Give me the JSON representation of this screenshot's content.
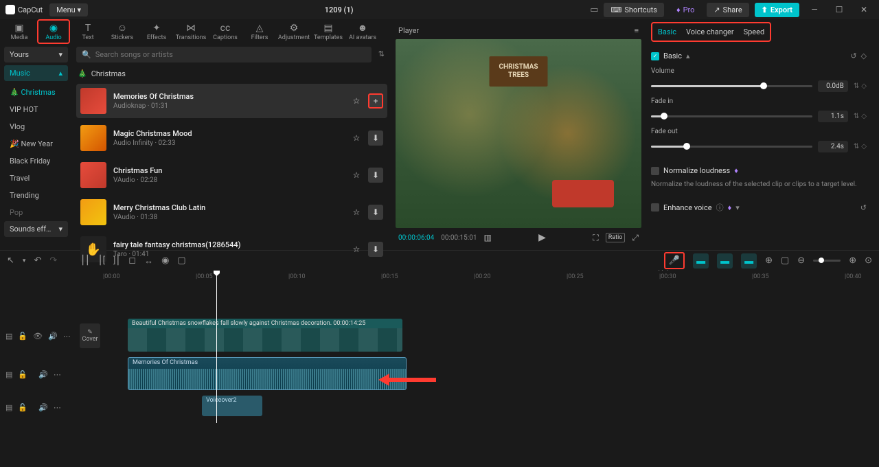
{
  "app": {
    "name": "CapCut",
    "menu": "Menu",
    "title": "1209 (1)"
  },
  "titlebar": {
    "shortcuts": "Shortcuts",
    "pro": "Pro",
    "share": "Share",
    "export": "Export"
  },
  "tools": {
    "media": "Media",
    "audio": "Audio",
    "text": "Text",
    "stickers": "Stickers",
    "effects": "Effects",
    "transitions": "Transitions",
    "captions": "Captions",
    "filters": "Filters",
    "adjustment": "Adjustment",
    "templates": "Templates",
    "avatars": "AI avatars"
  },
  "sidebar": {
    "yours": "Yours",
    "music": "Music",
    "cats": [
      "Christmas",
      "VIP HOT",
      "Vlog",
      "New Year",
      "Black Friday",
      "Travel",
      "Trending",
      "Pop"
    ],
    "sounds": "Sounds eff…"
  },
  "search": {
    "placeholder": "Search songs or artists"
  },
  "breadcrumb": "Christmas",
  "songs": [
    {
      "title": "Memories Of Christmas",
      "meta": "Audioknap · 01:31"
    },
    {
      "title": "Magic Christmas Mood",
      "meta": "Audio Infinity · 02:33"
    },
    {
      "title": "Christmas Fun",
      "meta": "VAudio · 02:28"
    },
    {
      "title": "Merry Christmas Club Latin",
      "meta": "VAudio · 01:38"
    },
    {
      "title": "fairy tale fantasy christmas(1286544)",
      "meta": "Taro · 01:41"
    }
  ],
  "player": {
    "label": "Player",
    "sign": "CHRISTMAS\nTREES",
    "time": "00:00:06:04",
    "duration": "00:00:15:01",
    "ratio": "Ratio"
  },
  "props": {
    "tabs": {
      "basic": "Basic",
      "voice": "Voice changer",
      "speed": "Speed"
    },
    "section": "Basic",
    "volume": {
      "label": "Volume",
      "value": "0.0dB"
    },
    "fadein": {
      "label": "Fade in",
      "value": "1.1s"
    },
    "fadeout": {
      "label": "Fade out",
      "value": "2.4s"
    },
    "normalize": {
      "label": "Normalize loudness",
      "desc": "Normalize the loudness of the selected clip or clips to a target level."
    },
    "enhance": {
      "label": "Enhance voice"
    }
  },
  "toolbar": {
    "voiceover": "Voiceover"
  },
  "timeline": {
    "ticks": [
      "|00:00",
      "|00:05",
      "|00:10",
      "|00:15",
      "|00:20",
      "|00:25",
      "|00:30",
      "|00:35",
      "|00:40"
    ],
    "cover": "Cover",
    "videoClip": "Beautiful Christmas snowflakes  fall slowly against Christmas decoration.   00:00:14:25",
    "audioClip": "Memories Of Christmas",
    "voClip": "Voiceover2"
  }
}
